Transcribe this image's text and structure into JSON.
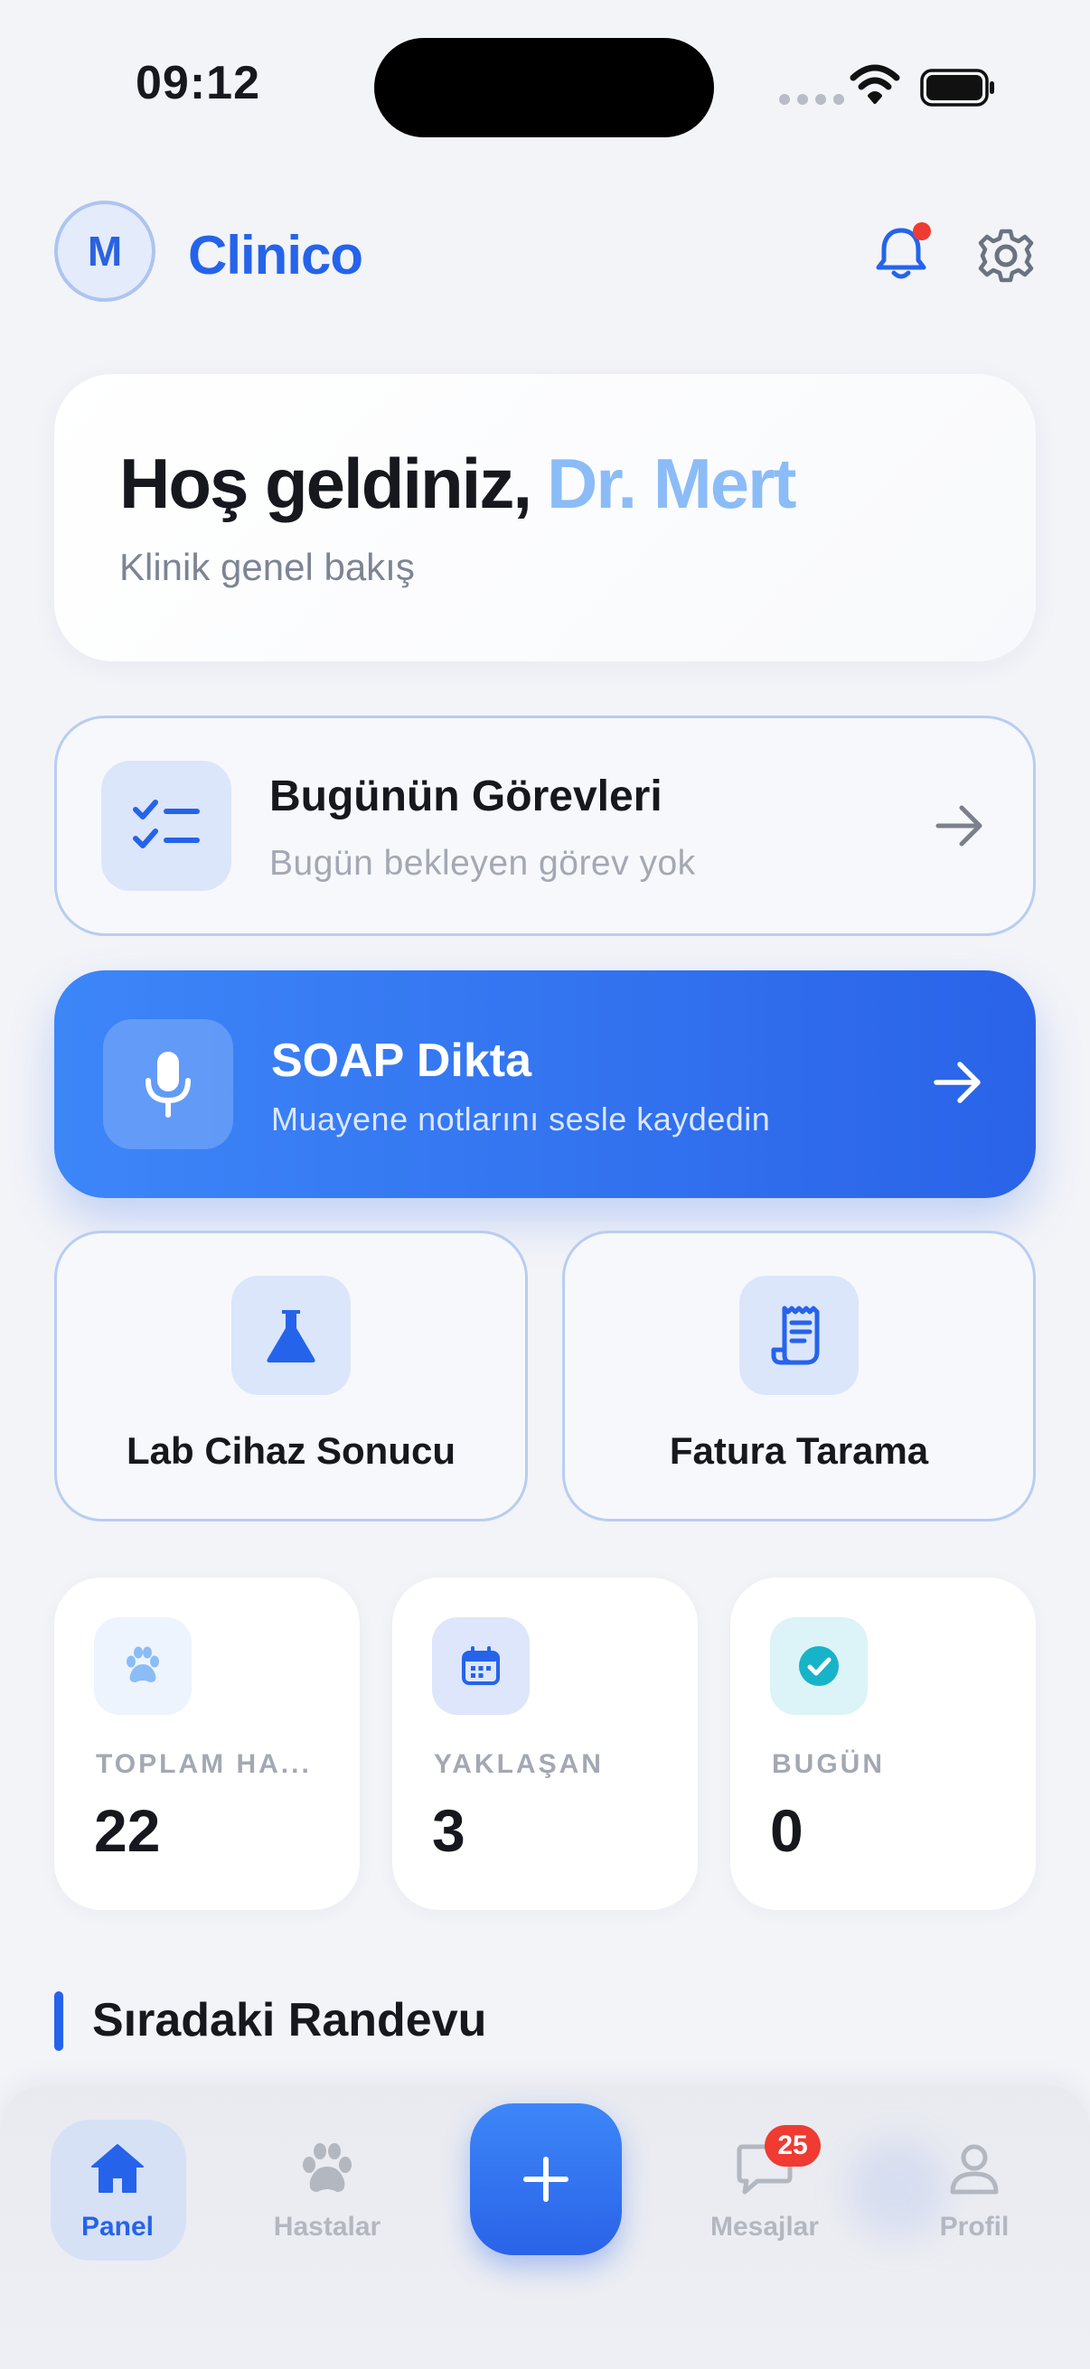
{
  "status_bar": {
    "time": "09:12"
  },
  "header": {
    "avatar_initial": "M",
    "brand": "Clinico"
  },
  "welcome": {
    "greeting": "Hoş geldiniz,",
    "name": "Dr. Mert",
    "subtitle": "Klinik genel bakış"
  },
  "tasks": {
    "title": "Bugünün Görevleri",
    "subtitle": "Bugün bekleyen görev yok"
  },
  "soap": {
    "title": "SOAP Dikta",
    "subtitle": "Muayene notlarını sesle kaydedin"
  },
  "actions": [
    {
      "label": "Lab Cihaz Sonucu",
      "icon": "flask-icon"
    },
    {
      "label": "Fatura Tarama",
      "icon": "receipt-icon"
    }
  ],
  "stats": [
    {
      "label": "TOPLAM HA...",
      "value": "22",
      "icon": "paw-icon"
    },
    {
      "label": "YAKLAŞAN",
      "value": "3",
      "icon": "calendar-icon"
    },
    {
      "label": "BUGÜN",
      "value": "0",
      "icon": "check-circle-icon"
    }
  ],
  "section": {
    "title": "Sıradaki Randevu"
  },
  "tabbar": {
    "items": [
      {
        "label": "Panel",
        "icon": "home-icon",
        "active": true
      },
      {
        "label": "Hastalar",
        "icon": "paw-icon",
        "active": false
      },
      {
        "label": "Mesajlar",
        "icon": "chat-icon",
        "active": false,
        "badge": "25"
      },
      {
        "label": "Profil",
        "icon": "user-icon",
        "active": false
      }
    ]
  },
  "colors": {
    "accent": "#2563eb",
    "accent_light": "#8bbcf7",
    "badge": "#ef3b32",
    "muted": "#a3a8b3"
  }
}
